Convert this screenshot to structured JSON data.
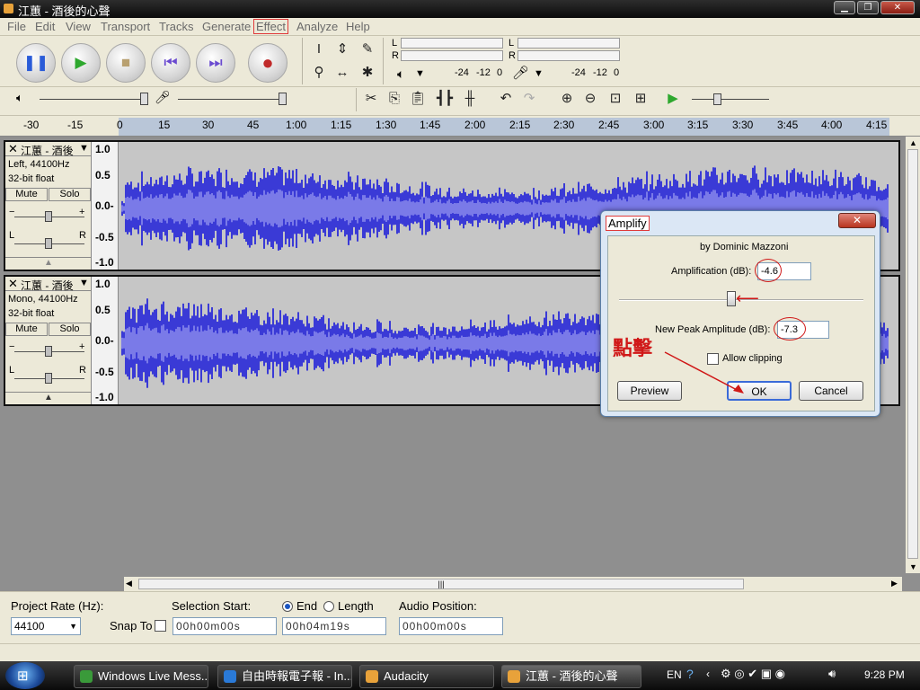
{
  "window": {
    "title": "江蕙 - 酒後的心聲"
  },
  "menu": [
    "File",
    "Edit",
    "View",
    "Transport",
    "Tracks",
    "Generate",
    "Effect",
    "Analyze",
    "Help"
  ],
  "meters": {
    "left": "L",
    "right": "R",
    "scale_a": "-24",
    "scale_b": "-12",
    "scale_c": "0"
  },
  "ruler": [
    "-30",
    "-15",
    "0",
    "15",
    "30",
    "45",
    "1:00",
    "1:15",
    "1:30",
    "1:45",
    "2:00",
    "2:15",
    "2:30",
    "2:45",
    "3:00",
    "3:15",
    "3:30",
    "3:45",
    "4:00",
    "4:15"
  ],
  "tracks": [
    {
      "name": "江蕙 - 酒後",
      "format": "Left, 44100Hz",
      "depth": "32-bit float",
      "mute": "Mute",
      "solo": "Solo",
      "scale": [
        "1.0",
        "0.5",
        "0.0-",
        "-0.5",
        "-1.0"
      ],
      "pan_l": "L",
      "pan_r": "R"
    },
    {
      "name": "江蕙 - 酒後",
      "format": "Mono, 44100Hz",
      "depth": "32-bit float",
      "mute": "Mute",
      "solo": "Solo",
      "scale": [
        "1.0",
        "0.5",
        "0.0-",
        "-0.5",
        "-1.0"
      ],
      "pan_l": "L",
      "pan_r": "R"
    }
  ],
  "dialog": {
    "title": "Amplify",
    "author": "by Dominic Mazzoni",
    "amp_label": "Amplification (dB):",
    "amp_value": "-4.6",
    "peak_label": "New Peak Amplitude (dB):",
    "peak_value": "-7.3",
    "allow_clipping": "Allow clipping",
    "preview": "Preview",
    "ok": "OK",
    "cancel": "Cancel",
    "annotation": "點擊",
    "slider_fraction": 0.46
  },
  "status": {
    "rate_label": "Project Rate (Hz):",
    "rate_value": "44100",
    "snap_label": "Snap To",
    "sel_start_label": "Selection Start:",
    "end_label": "End",
    "length_label": "Length",
    "audio_pos_label": "Audio Position:",
    "sel_start": "00h00m00s",
    "end": "00h04m19s",
    "audio_pos": "00h00m00s"
  },
  "taskbar": {
    "items": [
      "Windows Live Mess...",
      "自由時報電子報 - In...",
      "Audacity",
      "江蕙 - 酒後的心聲"
    ],
    "lang": "EN",
    "clock": "9:28 PM"
  },
  "colors": {
    "wave": "#3a3ad6",
    "wave_light": "#7a7ae8",
    "annotation": "#d01818"
  }
}
